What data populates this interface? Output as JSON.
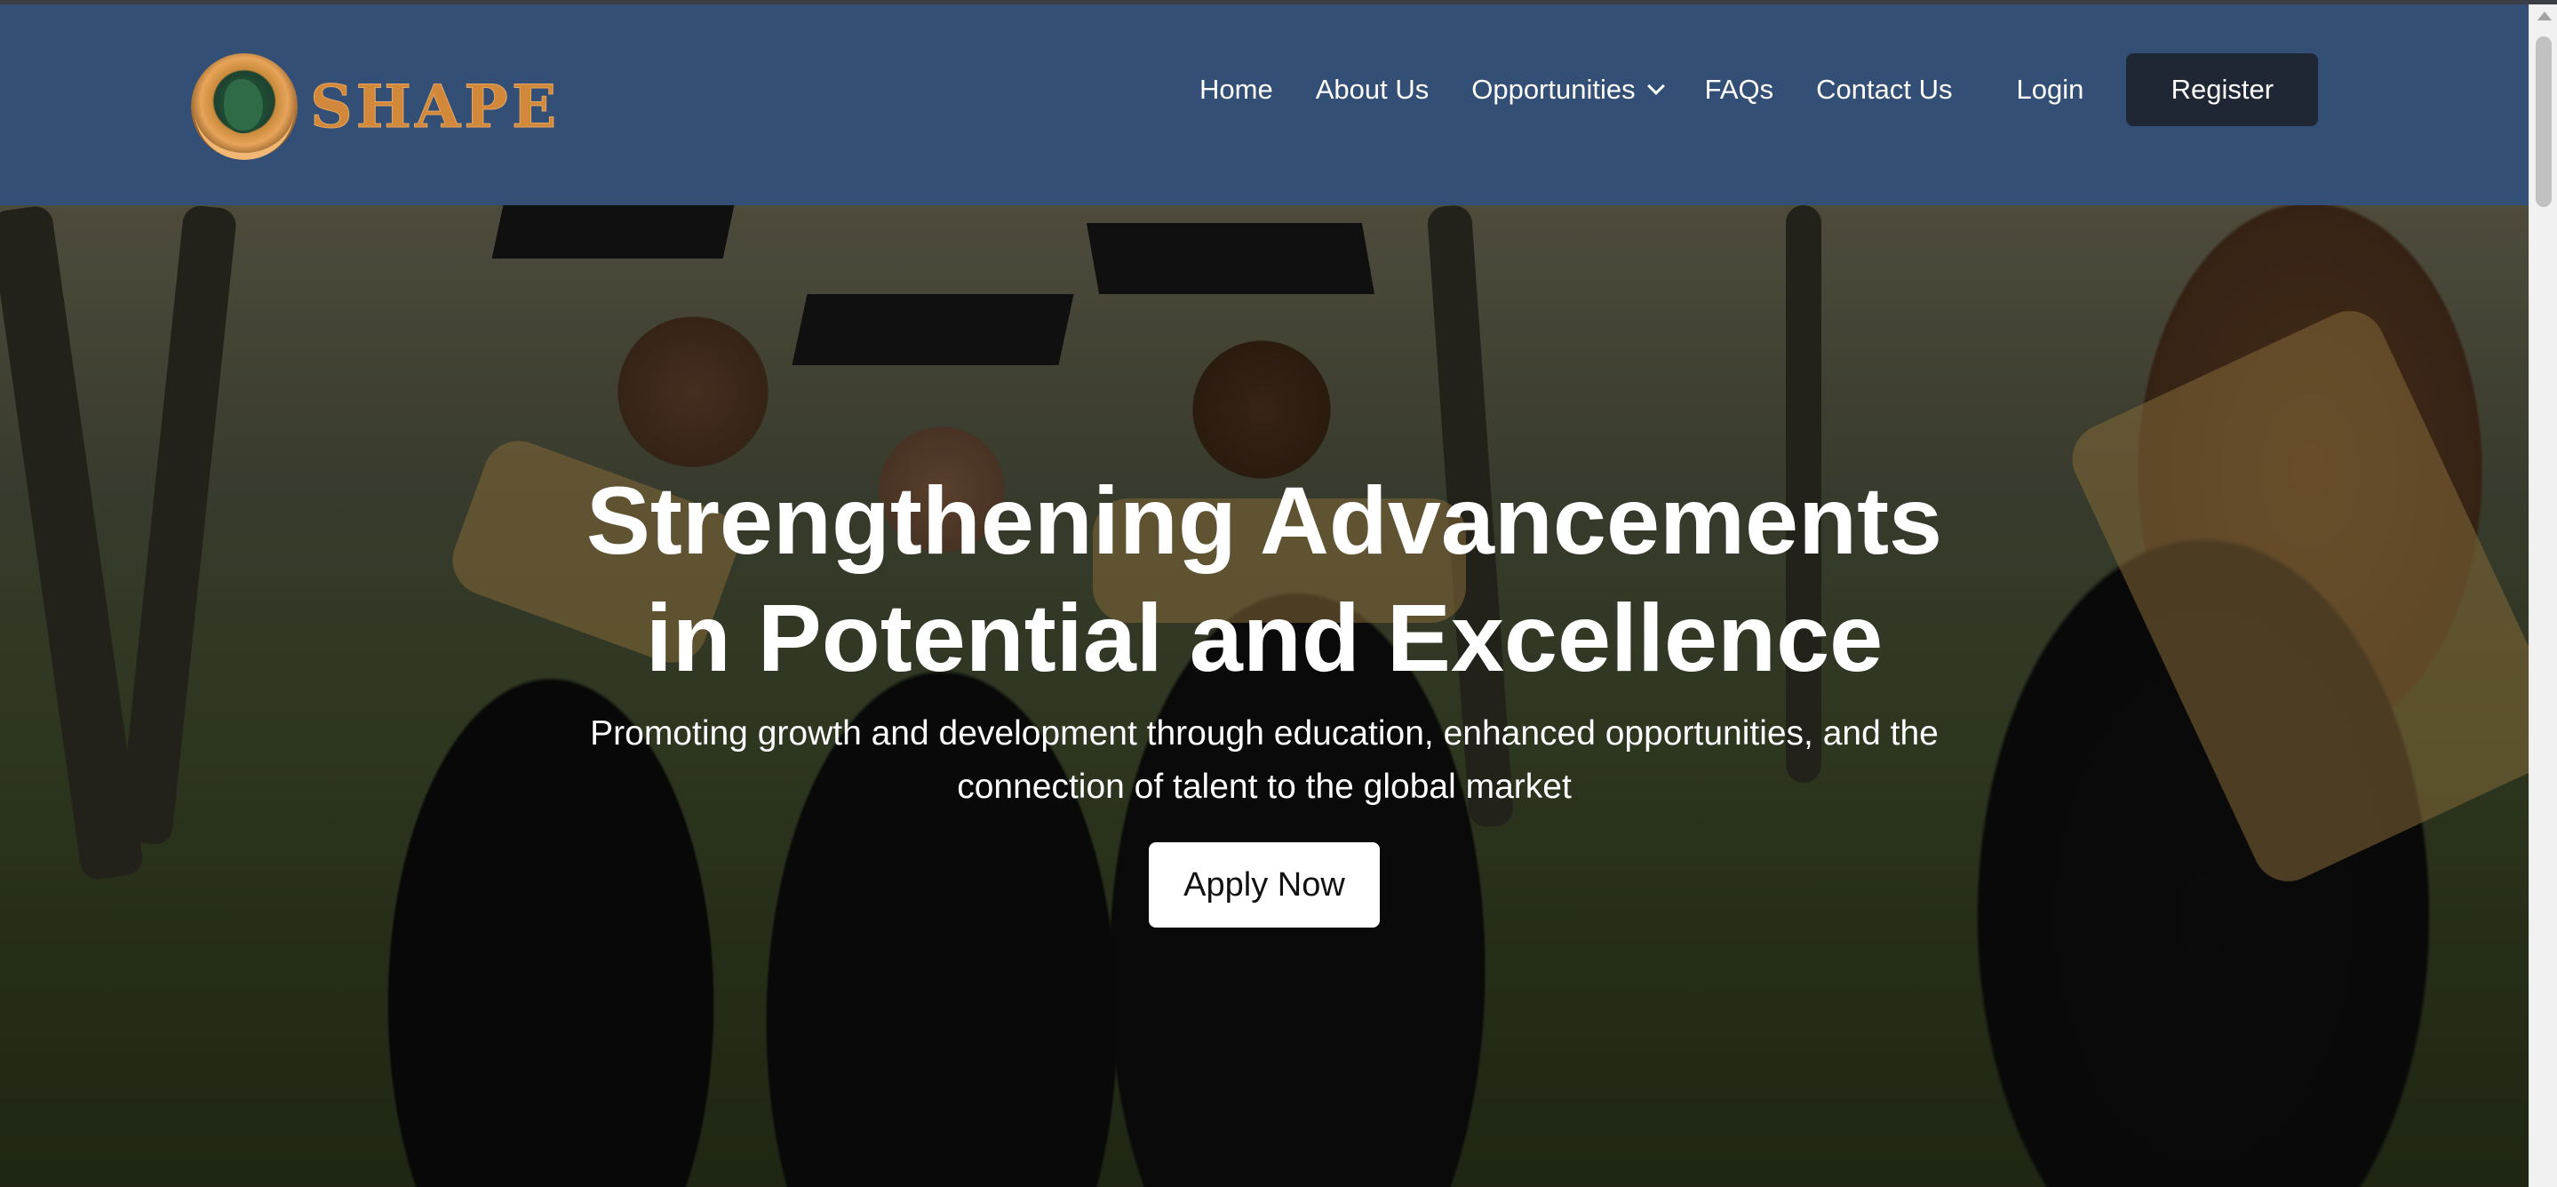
{
  "brand": {
    "name": "SHAPE",
    "logo_icon": "africa-globe-logo-icon"
  },
  "nav": {
    "items": [
      {
        "label": "Home"
      },
      {
        "label": "About Us"
      },
      {
        "label": "Opportunities",
        "icon": "chevron-down-icon"
      },
      {
        "label": "FAQs"
      },
      {
        "label": "Contact Us"
      }
    ],
    "login_label": "Login",
    "register_label": "Register"
  },
  "hero": {
    "title_line1": "Strengthening Advancements",
    "title_line2": "in Potential and Excellence",
    "subtitle_line1": "Promoting growth and development through education, enhanced opportunities, and the",
    "subtitle_line2": "connection of talent to the global market",
    "cta_label": "Apply Now",
    "background_image": "graduates-in-caps-and-gowns-photo"
  },
  "colors": {
    "header_bg": "#334f76",
    "register_bg": "#1f2634",
    "brand_gold": "#d2883a",
    "text_light": "#ffffff",
    "cta_bg": "#ffffff"
  }
}
